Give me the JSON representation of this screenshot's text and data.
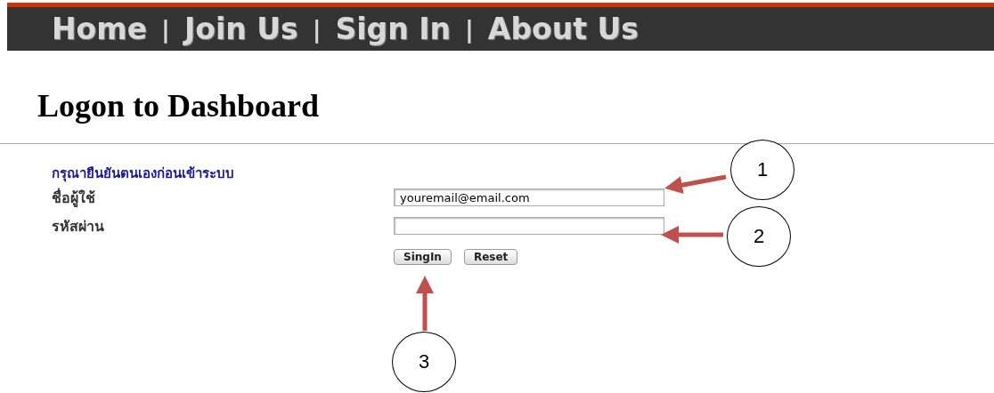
{
  "nav": {
    "items": [
      "Home",
      "Join Us",
      "Sign In",
      "About Us"
    ],
    "separators": [
      "|",
      "|",
      "|"
    ]
  },
  "page_title": "Logon to Dashboard",
  "form": {
    "heading": "กรุณายืนยันตนเองก่อนเข้าระบบ",
    "fields": [
      {
        "label": "ชื่อผู้ใช้",
        "value": "youremail@email.com"
      },
      {
        "label": "รหัสผ่าน"
      }
    ],
    "buttons": [
      "SingIn",
      "Reset"
    ]
  },
  "callouts": [
    "1",
    "2",
    "3"
  ]
}
